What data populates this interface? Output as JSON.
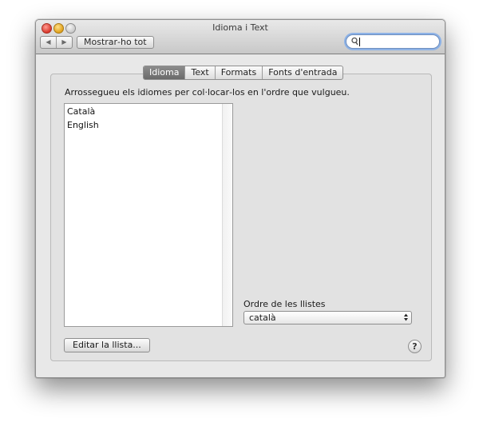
{
  "window": {
    "title": "Idioma i Text"
  },
  "toolbar": {
    "back_icon": "back-arrow-icon",
    "forward_icon": "forward-arrow-icon",
    "show_all_label": "Mostrar‑ho tot",
    "search_value": "",
    "search_icon": "magnifier-icon"
  },
  "tabs": [
    {
      "label": "Idioma",
      "active": true
    },
    {
      "label": "Text",
      "active": false
    },
    {
      "label": "Formats",
      "active": false
    },
    {
      "label": "Fonts d'entrada",
      "active": false
    }
  ],
  "main": {
    "instructions": "Arrossegueu els idiomes per col·locar‑los en l'ordre que vulgueu.",
    "languages": [
      "Català",
      "English"
    ],
    "order_label": "Ordre de les llistes",
    "order_value": "català",
    "edit_list_label": "Editar la llista...",
    "help_label": "?"
  }
}
